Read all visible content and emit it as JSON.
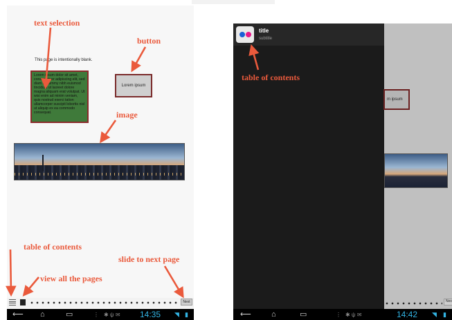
{
  "left_screen": {
    "blank_text": "This page is intentionally blank.",
    "text_box": "Lorem ipsum dolor sit amet, consectetuer adipiscing elit, sed diam nonummy nibh euismod tincidunt ut laoreet dolore magna aliquam erat volutpat. Ut wisi enim ad minim veniam, quis nostrud exerci tation ullamcorper suscipit lobortis nisl ut aliquip ex ea commodo consequat.",
    "button_label": "Lorem ipsum",
    "next_label": "Next",
    "clock": "14:35"
  },
  "right_screen": {
    "drawer_title": "title",
    "drawer_subtitle": "subtitle",
    "button_partial": "m ipsum",
    "next_partial": "Nex",
    "clock": "14:42"
  },
  "annotations": {
    "text_selection": "text selection",
    "button": "button",
    "image": "image",
    "table_of_contents": "table of contents",
    "view_all_pages": "view all the pages",
    "slide_next": "slide to next page",
    "table_of_contents_right": "table of contents"
  },
  "colors": {
    "annotation": "#ea5a3c",
    "text_box_bg": "#3f7a3a",
    "border_red": "#8a2a2a",
    "status_accent": "#33b5e5",
    "drawer_bg": "#1b1b1b"
  }
}
